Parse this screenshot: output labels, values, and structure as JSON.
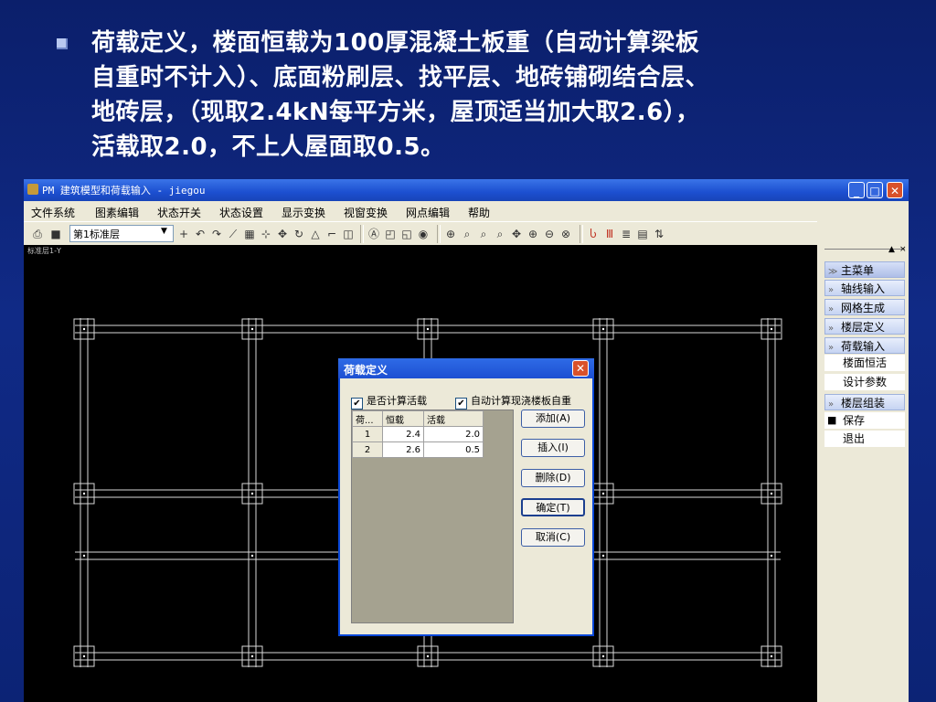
{
  "slide": {
    "lines": [
      "荷载定义，楼面恒载为100厚混凝土板重（自动计算梁板",
      "自重时不计入）、底面粉刷层、找平层、地砖铺砌结合层、",
      "地砖层，（现取2.4kN每平方米，屋顶适当加大取2.6），",
      "活载取2.0，不上人屋面取0.5。"
    ]
  },
  "window": {
    "title": "PM 建筑模型和荷载输入 - jiegou",
    "minimize": "_",
    "maximize": "□",
    "close": "✕"
  },
  "menu": [
    "文件系统",
    "图素编辑",
    "状态开关",
    "状态设置",
    "显示变换",
    "视窗变换",
    "网点编辑",
    "帮助"
  ],
  "toolbar": {
    "floor_select": "第1标准层"
  },
  "canvas": {
    "label": "标准层1-Y"
  },
  "side_panel": {
    "mini_up": "▲",
    "mini_close": "×",
    "items": [
      {
        "label": "主菜单",
        "type": "head"
      },
      {
        "label": "轴线输入",
        "type": "head"
      },
      {
        "label": "网格生成",
        "type": "head"
      },
      {
        "label": "楼层定义",
        "type": "head"
      },
      {
        "label": "荷载输入",
        "type": "head"
      },
      {
        "label": "楼面恒活",
        "type": "sub"
      },
      {
        "label": "设计参数",
        "type": "sub"
      },
      {
        "label": "楼层组装",
        "type": "head"
      },
      {
        "label": "保存",
        "type": "sub2"
      },
      {
        "label": "退出",
        "type": "sub2"
      }
    ]
  },
  "dialog": {
    "title": "荷载定义",
    "check1": "是否计算活载",
    "check2": "自动计算现浇楼板自重",
    "columns": [
      "荷...",
      "恒载",
      "活载"
    ],
    "rows": [
      {
        "id": "1",
        "dead": "2.4",
        "live": "2.0"
      },
      {
        "id": "2",
        "dead": "2.6",
        "live": "0.5"
      }
    ],
    "buttons": {
      "add": "添加(A)",
      "insert": "插入(I)",
      "delete": "删除(D)",
      "ok": "确定(T)",
      "cancel": "取消(C)"
    }
  }
}
